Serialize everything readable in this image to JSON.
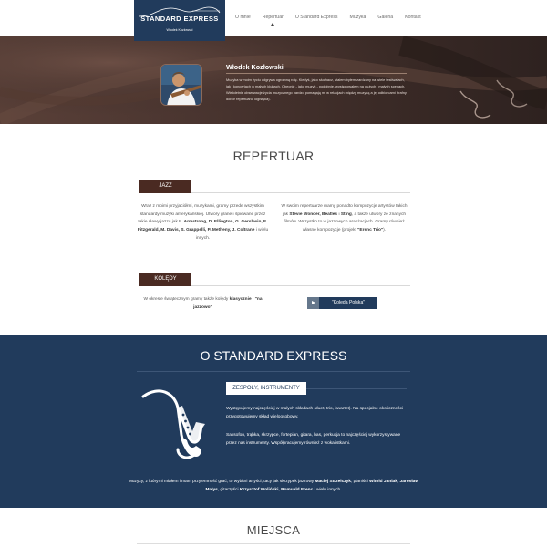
{
  "nav": {
    "logo_title": "STANDARD EXPRESS",
    "logo_subtitle": "Włodek Kozłowski",
    "items": [
      {
        "label": "O mnie"
      },
      {
        "label": "Repertuar",
        "active": true
      },
      {
        "label": "O Standard Express"
      },
      {
        "label": "Muzyka"
      },
      {
        "label": "Galeria"
      },
      {
        "label": "Kontakt"
      }
    ]
  },
  "hero": {
    "name": "Włodek Kozłowski",
    "text": "Muzyka w moim życiu odgrywa ogromną rolę. Kiedyś, jako słuchacz, stałem byłem zardzany na wiele festiwalach, jak i koncertach w małych klubach. Obecnie - jako muzyk - podobnie, występowałem na dużych i małych scenach. Wieloletnie obserwacje życia muzycznego bardzo pomagają mi w relacjach między muzyką a jej odbiorcami (trafny dobór repertuaru, logistyka)."
  },
  "repertuar": {
    "title": "REPERTUAR",
    "jazz_tab": "JAZZ",
    "jazz_left_pre": "Wraz z moimi przyjaciółmi, muzykami, gramy przede wszystkim standardy muzyki amerykańskiej. Utwory grane i śpiewane przez takie sławy jazzu jak ",
    "jazz_left_bold": "L. Armstrong, D. Ellington, G. Gershwin, E. Fitzgerald, M. Davis, S. Grappelli, P. Metheny, J. Coltrane",
    "jazz_left_post": " i wielu innych.",
    "jazz_right_pre": "W swoim repertuarze mamy ponadto kompozycje artystów takich jak ",
    "jazz_right_bold1": "Stevie Wonder, Beatles",
    "jazz_right_mid1": " i ",
    "jazz_right_bold2": "Sting",
    "jazz_right_mid2": ", a także utwory ze znanych filmów. Wszystko to w jazzowych aranżacjach. Gramy również własne kompozycje (projekt ",
    "jazz_right_bold3": "\"Erenc Trio\"",
    "jazz_right_post": ").",
    "koledy_tab": "KOLĘDY",
    "koledy_pre": "W okresie świątecznym gramy także kolędy ",
    "koledy_bold": "klasycznie i \"na jazzowo\"",
    "koledy_button": "\"Kolęda Polska\""
  },
  "standard_express": {
    "title": "O STANDARD EXPRESS",
    "tab": "ZESPOŁY, INSTRUMENTY",
    "p1": "Występujemy najczęściej w małych składach (duet, trio, kwartet). Na specjalne okoliczności przygotowujemy skład wieloosobowy.",
    "p2": "Saksofon, trąbka, skrzypce, fortepian, gitara, bas, perkusja to najczęściej wykorzystywane przez nas instrumenty. Współpracujemy również z wokalistkami.",
    "bottom_1": "Muzycy, z którymi miałem i mam przyjemność grać, to wybitni artyści, tacy jak skrzypek jazzowy ",
    "bottom_b1": "Maciej Strzelczyk",
    "bottom_2": ", pianiści ",
    "bottom_b2": "Witold Janiak",
    "bottom_3": ", ",
    "bottom_b3": "Jarosław Małys",
    "bottom_4": ", gitarzyści ",
    "bottom_b4": "Krzysztof Woliński",
    "bottom_5": ", ",
    "bottom_b5": "Romuald Erenc",
    "bottom_6": " i wielu innych."
  },
  "miejsca": {
    "title": "MIEJSCA"
  },
  "colors": {
    "navy": "#213b5c",
    "brown_tab": "#4a2a22",
    "hero_bg": "#4a3530"
  }
}
